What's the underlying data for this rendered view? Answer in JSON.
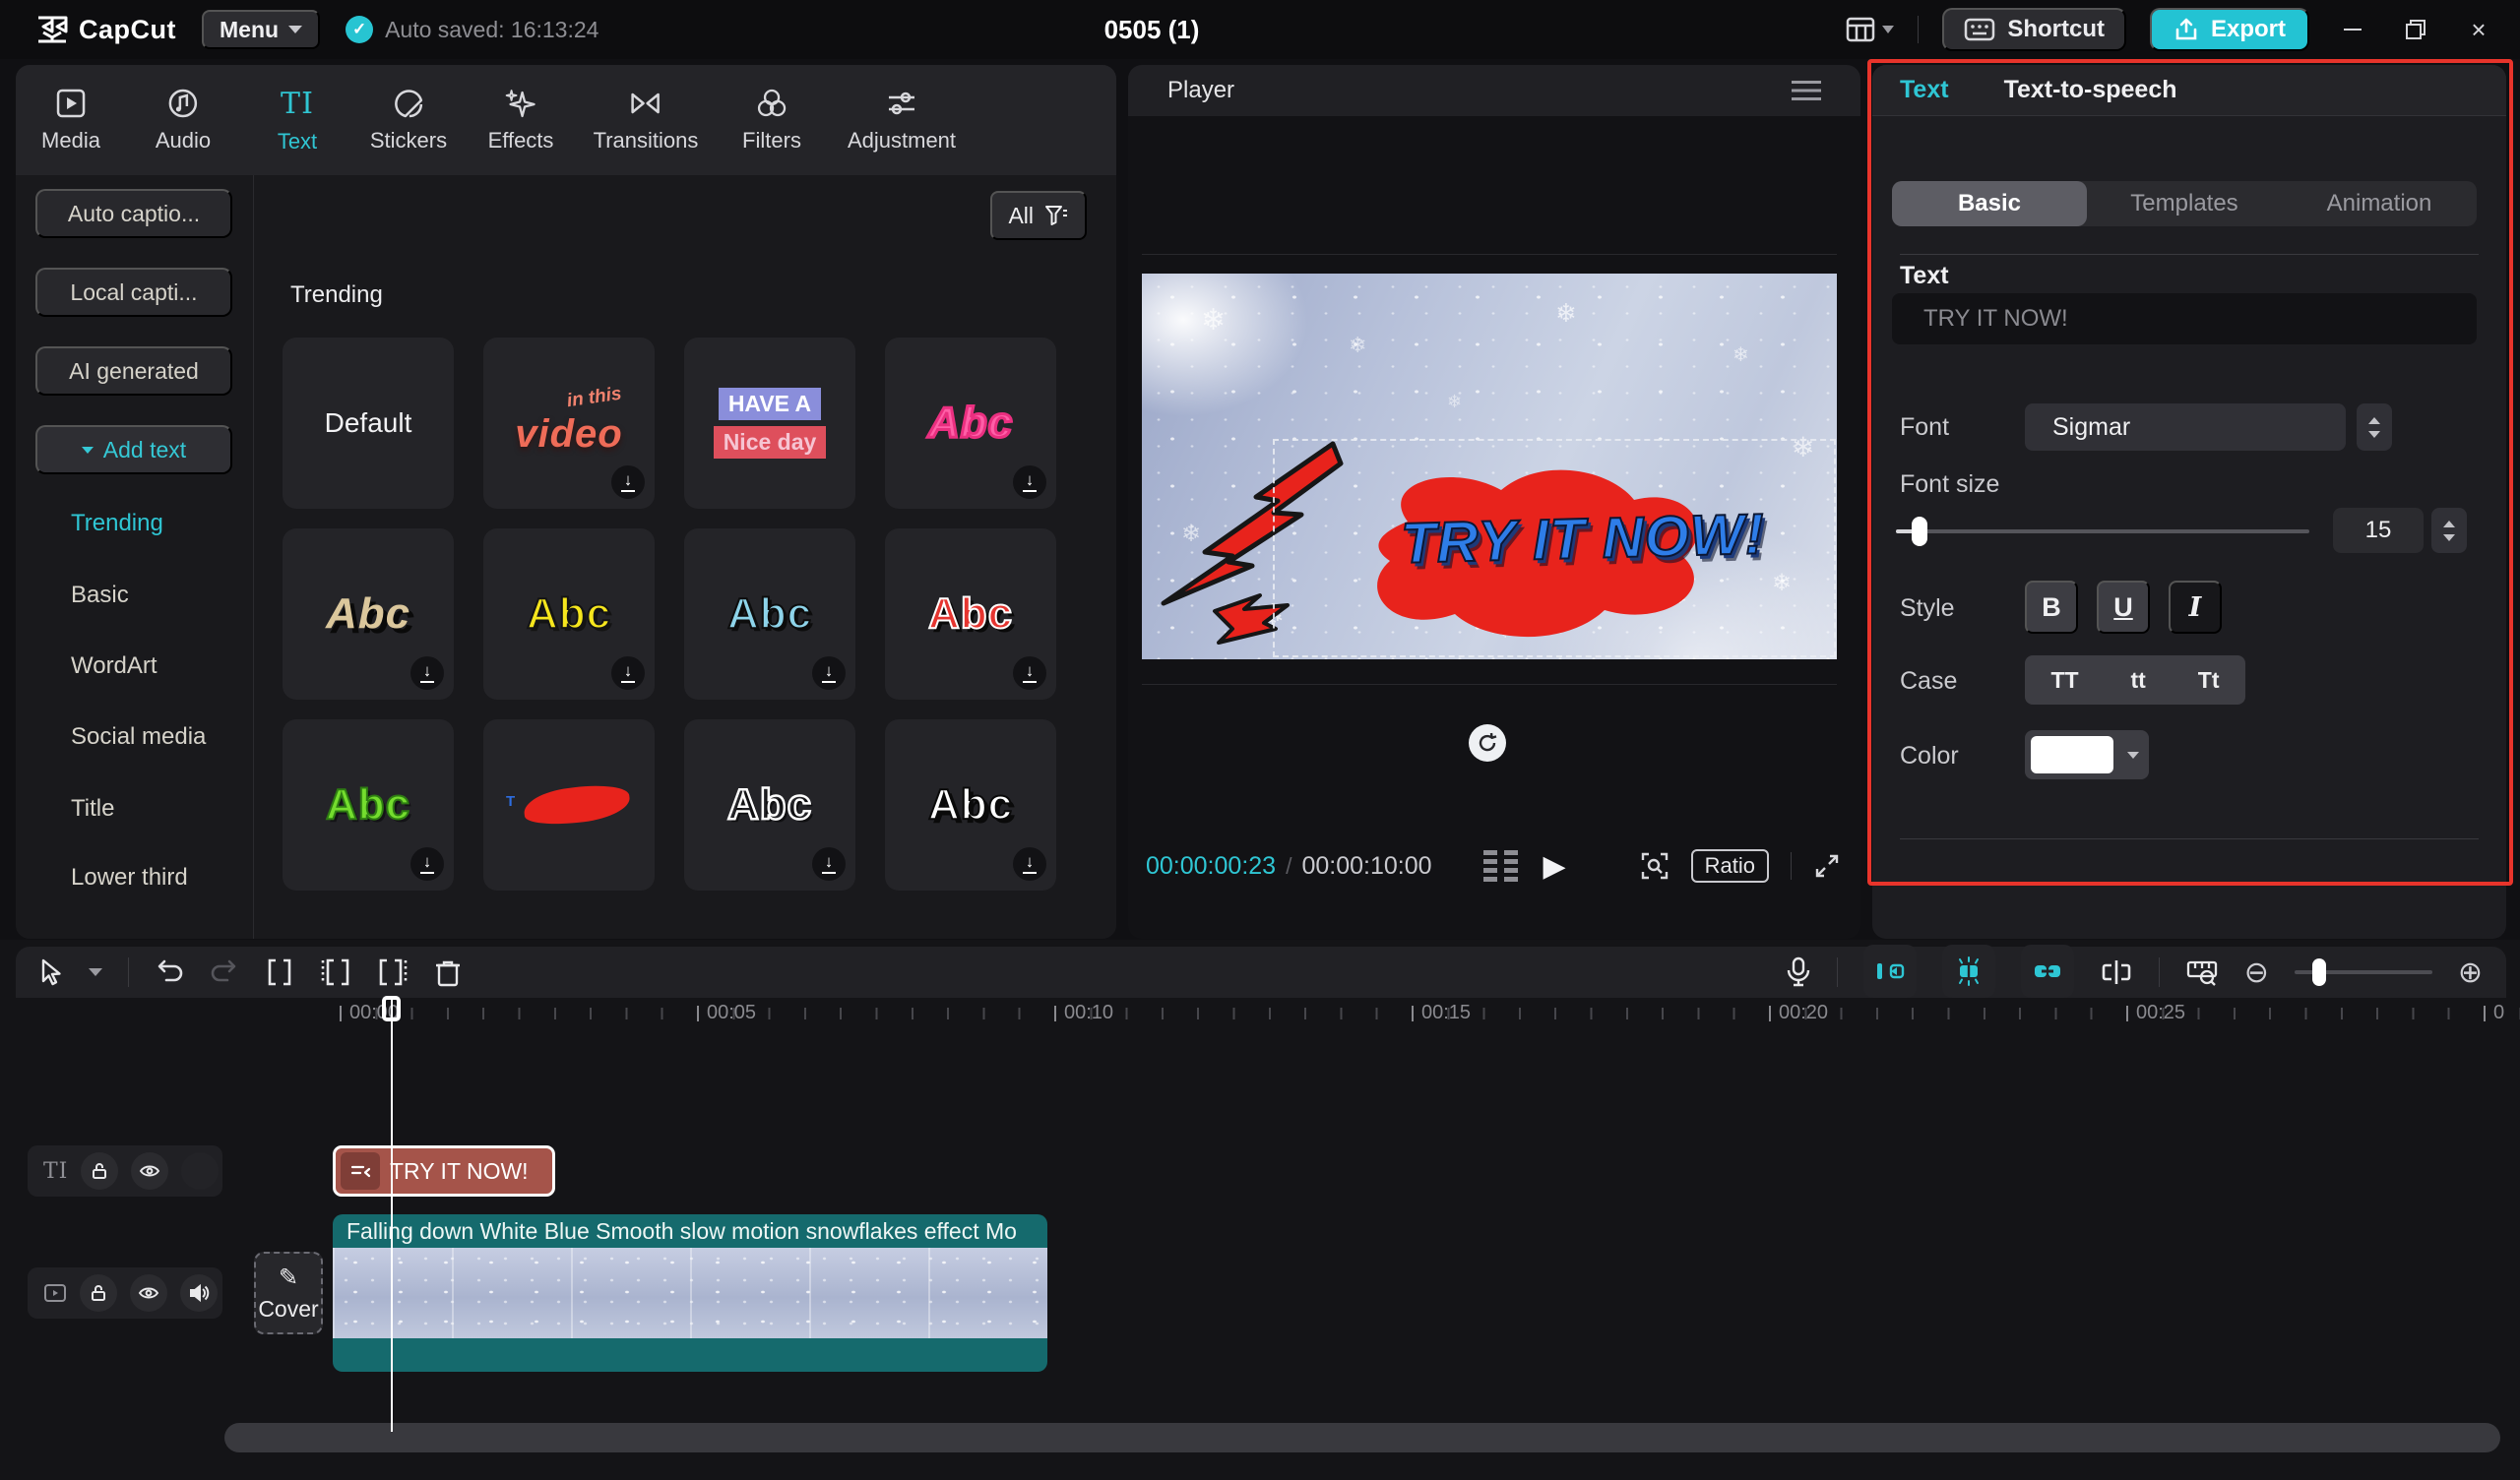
{
  "titlebar": {
    "app_name": "CapCut",
    "menu_label": "Menu",
    "autosave_text": "Auto saved: 16:13:24",
    "project_title": "0505 (1)",
    "shortcut_label": "Shortcut",
    "export_label": "Export"
  },
  "nav": {
    "tabs": [
      "Media",
      "Audio",
      "Text",
      "Stickers",
      "Effects",
      "Transitions",
      "Filters",
      "Adjustment"
    ],
    "active_tab": "Text"
  },
  "sidebar": {
    "buttons": [
      "Auto captio...",
      "Local capti...",
      "AI generated",
      "Add text"
    ],
    "links": [
      "Trending",
      "Basic",
      "WordArt",
      "Social media",
      "Title",
      "Lower third"
    ],
    "active_link": "Trending"
  },
  "library": {
    "filter_label": "All",
    "section_title": "Trending",
    "cards": [
      {
        "label": "Default"
      },
      {
        "sub": "in this",
        "label": "video"
      },
      {
        "line1": "HAVE A",
        "line2": "Nice day"
      },
      {
        "label": "Abc"
      },
      {
        "label": "Abc"
      },
      {
        "label": "Abc"
      },
      {
        "label": "Abc"
      },
      {
        "label": "Abc"
      },
      {
        "label": "Abc"
      },
      {
        "label": "T"
      },
      {
        "label": "Abc"
      },
      {
        "label": "Abc"
      }
    ]
  },
  "player": {
    "title": "Player",
    "current_time": "00:00:00:23",
    "time_separator": "/",
    "duration": "00:00:10:00",
    "ratio_label": "Ratio",
    "preview_text": "TRY IT NOW!"
  },
  "inspector": {
    "tabs": [
      "Text",
      "Text-to-speech"
    ],
    "sub_tabs": [
      "Basic",
      "Templates",
      "Animation"
    ],
    "active_sub_tab": "Basic",
    "text_label": "Text",
    "text_value": "TRY IT NOW!",
    "font_label": "Font",
    "font_value": "Sigmar",
    "size_label": "Font size",
    "size_value": "15",
    "style_label": "Style",
    "style_options": [
      "B",
      "U",
      "I"
    ],
    "case_label": "Case",
    "case_options": [
      "TT",
      "tt",
      "Tt"
    ],
    "color_label": "Color"
  },
  "timeline": {
    "ruler_labels": [
      "00:00",
      "00:05",
      "00:10",
      "00:15",
      "00:20",
      "00:25",
      "0"
    ],
    "text_clip_label": "TRY IT NOW!",
    "video_clip_label": "Falling down White Blue Smooth slow motion snowflakes effect Mo",
    "cover_label": "Cover"
  },
  "colors": {
    "accent_cyan": "#2fc6d4",
    "export_teal": "#23c3d3",
    "annotation_red": "#e8342b",
    "text_clip_bg": "#a5544a",
    "video_clip_teal": "#156a6d",
    "preview_text_blue": "#2e7de8",
    "blob_red": "#e8231c"
  }
}
